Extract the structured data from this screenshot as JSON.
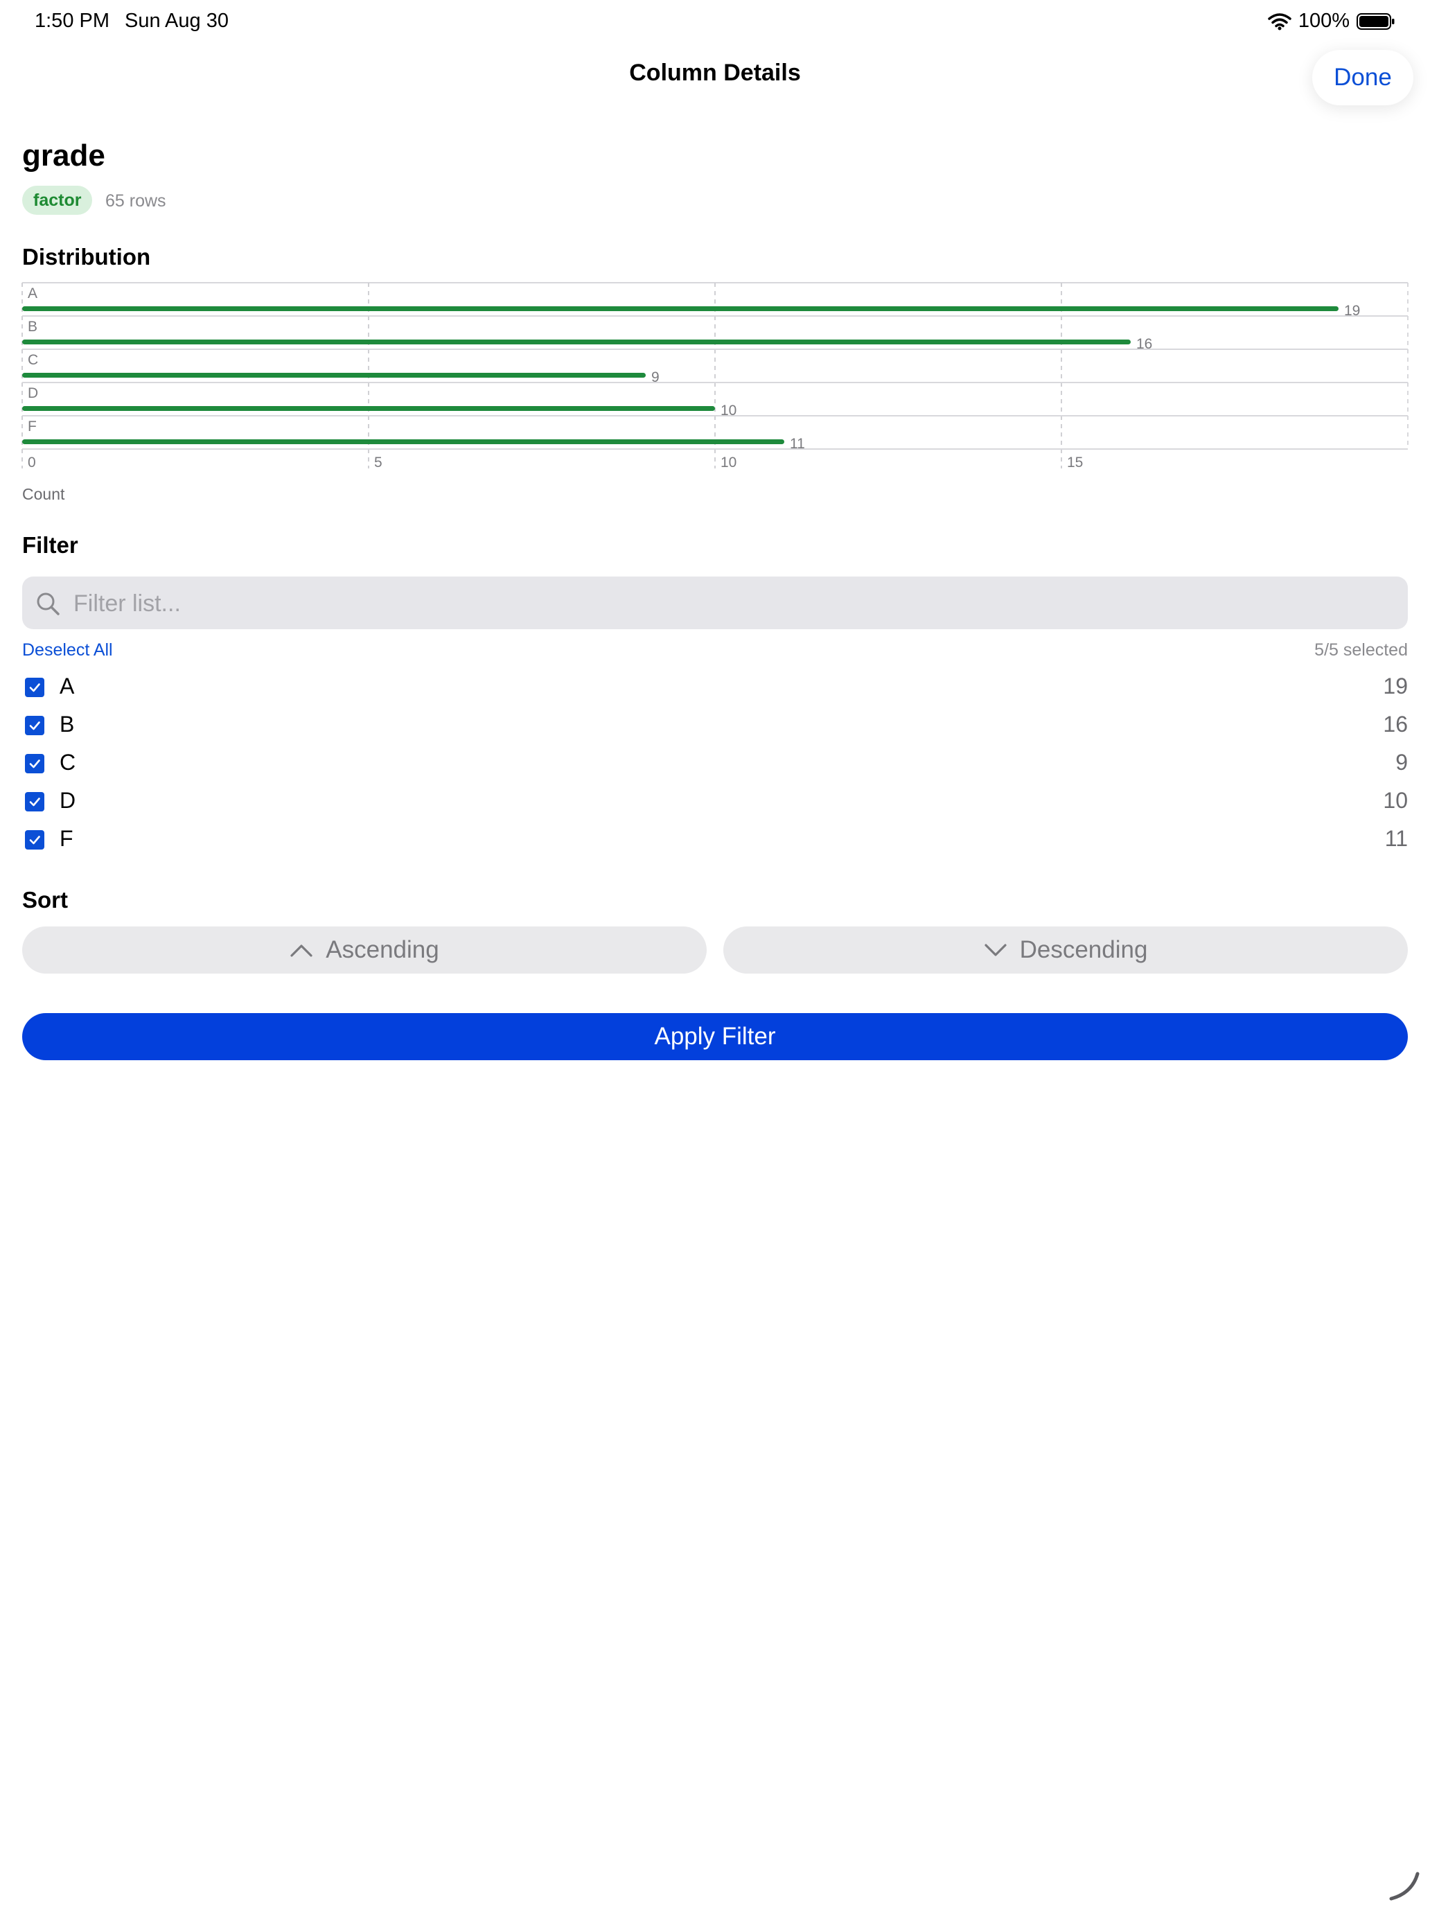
{
  "status_bar": {
    "time": "1:50 PM",
    "date": "Sun Aug 30",
    "battery": "100%"
  },
  "nav": {
    "title": "Column Details",
    "done_label": "Done"
  },
  "column": {
    "name": "grade",
    "type": "factor",
    "rows": "65 rows"
  },
  "distribution": {
    "title": "Distribution"
  },
  "chart_data": {
    "type": "bar",
    "orientation": "horizontal",
    "categories": [
      "A",
      "B",
      "C",
      "D",
      "F"
    ],
    "values": [
      19,
      16,
      9,
      10,
      11
    ],
    "xlabel": "Count",
    "xlim": [
      0,
      20
    ],
    "xticks": [
      0,
      5,
      10,
      15
    ],
    "grid": true,
    "bar_color": "#1e8a3c"
  },
  "filter": {
    "title": "Filter",
    "search_placeholder": "Filter list...",
    "deselect_label": "Deselect All",
    "selected_text": "5/5 selected",
    "items": [
      {
        "label": "A",
        "count": "19",
        "checked": true
      },
      {
        "label": "B",
        "count": "16",
        "checked": true
      },
      {
        "label": "C",
        "count": "9",
        "checked": true
      },
      {
        "label": "D",
        "count": "10",
        "checked": true
      },
      {
        "label": "F",
        "count": "11",
        "checked": true
      }
    ]
  },
  "sort": {
    "title": "Sort",
    "ascending_label": "Ascending",
    "descending_label": "Descending"
  },
  "apply_label": "Apply Filter",
  "colors": {
    "accent": "#0b4fd6",
    "apply": "#0340dc",
    "bar": "#1e8a3c",
    "pill_bg": "#d9f0dd"
  },
  "icons": {
    "search": "magnifier-icon",
    "check": "checkmark-icon",
    "ascending": "chevron-up-icon",
    "descending": "chevron-down-icon"
  }
}
